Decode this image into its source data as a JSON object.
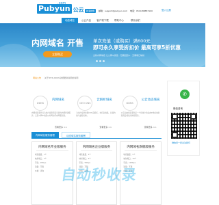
{
  "header": {
    "logo_text": "Pubyun",
    "logo_com": ".com",
    "logo_cn": "公云",
    "badge": "新浪微博",
    "email_label": "邮箱：support@pubyun.com",
    "phone_label": "电话：0510-88887100",
    "login": "登入注册"
  },
  "nav": {
    "items": [
      "动态域名",
      "公云产品",
      "客户端下载",
      "帮助中心",
      "联系我们"
    ],
    "active": 0
  },
  "banner": {
    "title": "内网域名 开售",
    "button": "立即购买",
    "line1": "单次充值（或购买）满600元",
    "line2": "即可永久享受折扣价 最高可享5折优惠",
    "line3": "全新内网域名 让公网ip穿透 · 无需固定ip · 无需端口映射",
    "accent": "#f39a1d",
    "brand": "#1a8fd6"
  },
  "notice": {
    "label": "网站公告",
    "text": "关于IPV6,DDNS功能更新说明的说明"
  },
  "cards": [
    {
      "icon_text": "DDNS",
      "title": "内网域名",
      "desc": "内网域名服务可为用户提供稳定可靠的内网穿透服务，无需公网IP也能从外网访问内网服务器。",
      "more": "查看更多 >>"
    },
    {
      "icon_text": "GEO DNS",
      "title": "云解析域名",
      "desc": "为用户提供智能DNS云解析，支持多线路、负载均衡与故障切换。",
      "more": "查看更多 >>"
    },
    {
      "icon_text": "DDNS",
      "title": "公云动态域名",
      "desc": "公云动态域名服务是一个将用户的动态IP地址映射到固定域名的解析服务。",
      "more": "查看更多 >>"
    }
  ],
  "sidebar": {
    "title": "微信咨询",
    "footer": "微信扫一扫关注我们"
  },
  "tabs": [
    "内网域名服务套餐",
    "动态域名服务套餐"
  ],
  "plans": [
    {
      "title": "内网域名专业版服务",
      "items": [
        "域名数量：1个",
        "映射端口：2个",
        "带宽：2Mbps",
        "流量：不限",
        "价格：详询"
      ]
    },
    {
      "title": "内网域名企业版服务",
      "items": [
        "域名数量：3个",
        "映射端口：5个",
        "带宽：5Mbps",
        "流量：不限",
        "价格：详询"
      ]
    },
    {
      "title": "内网域名旗舰版服务",
      "items": [
        "域名数量：5个",
        "映射端口：10个",
        "带宽：10Mbps",
        "流量：不限",
        "价格：详询"
      ]
    }
  ],
  "watermark": "自动秒收录"
}
